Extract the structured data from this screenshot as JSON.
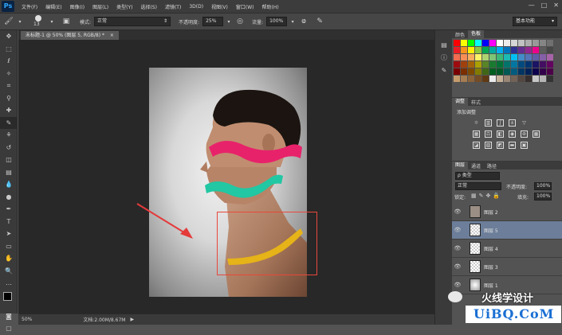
{
  "app": {
    "logo": "Ps"
  },
  "menu": [
    "文件(F)",
    "编辑(E)",
    "图像(I)",
    "图层(L)",
    "类型(Y)",
    "选择(S)",
    "滤镜(T)",
    "3D(D)",
    "视图(V)",
    "窗口(W)",
    "帮助(H)"
  ],
  "window_controls": [
    "—",
    "□",
    "✕"
  ],
  "options": {
    "brush_size": "13",
    "mode_label": "模式:",
    "mode_value": "正常",
    "opacity_label": "不透明度:",
    "opacity_value": "25%",
    "flow_label": "流量:",
    "flow_value": "100%",
    "workspace": "基本功能"
  },
  "document": {
    "tab_title": "未标题-1 @ 50% (图层 5, RGB/8) *",
    "close": "×",
    "zoom": "50%",
    "doc_info": "文档:2.00M/8.67M"
  },
  "swatch_panel": {
    "tabs": [
      "颜色",
      "色板"
    ],
    "active_tab": 1
  },
  "adjust_panel": {
    "tabs": [
      "调整",
      "样式"
    ],
    "title": "添加调整"
  },
  "layers_panel": {
    "tabs": [
      "图层",
      "通道",
      "路径"
    ],
    "filter": "ρ 类型",
    "blend_mode": "正常",
    "opacity_label": "不透明度:",
    "opacity_value": "100%",
    "lock_label": "锁定:",
    "fill_label": "填充:",
    "fill_value": "100%",
    "layers": [
      {
        "name": "图层 2",
        "selected": false
      },
      {
        "name": "图层 5",
        "selected": true
      },
      {
        "name": "图层 4",
        "selected": false
      },
      {
        "name": "图层 3",
        "selected": false
      },
      {
        "name": "图层 1",
        "selected": false
      }
    ]
  },
  "watermark": {
    "account": "火线学设计",
    "site": "UiBQ.CoM"
  },
  "colors": {
    "pink_ribbon": "#e8226a",
    "teal_ribbon": "#22c7a3",
    "yellow_ribbon": "#e6b318",
    "arrow": "#e43a3a",
    "selection_box": "#e8473b",
    "selected_layer": "#6c7e99"
  }
}
